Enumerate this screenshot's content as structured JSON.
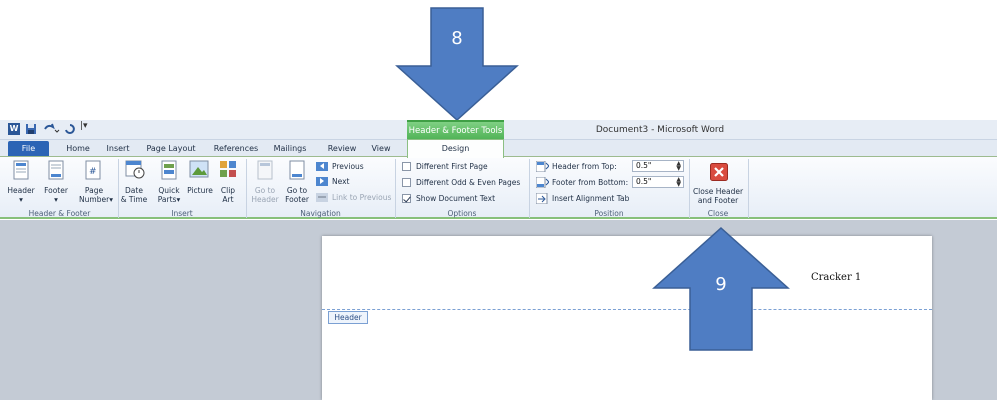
{
  "callouts": {
    "arrow1_number": "8",
    "arrow2_number": "9",
    "arrow_color": "#4f7dc3"
  },
  "window": {
    "document_title": "Document3  -  Microsoft Word",
    "contextual_tab": "Header & Footer Tools",
    "qat_icons": [
      "word-app-icon",
      "save-icon",
      "undo-icon",
      "redo-icon",
      "qat-customize-icon"
    ]
  },
  "tabs": [
    {
      "label": "File",
      "active": false
    },
    {
      "label": "Home",
      "active": false
    },
    {
      "label": "Insert",
      "active": false
    },
    {
      "label": "Page Layout",
      "active": false
    },
    {
      "label": "References",
      "active": false
    },
    {
      "label": "Mailings",
      "active": false
    },
    {
      "label": "Review",
      "active": false
    },
    {
      "label": "View",
      "active": false
    },
    {
      "label": "Design",
      "active": true
    }
  ],
  "ribbon": {
    "header_footer_group": {
      "label": "Header & Footer",
      "header": "Header",
      "footer": "Footer",
      "page_number_1": "Page",
      "page_number_2": "Number"
    },
    "insert_group": {
      "label": "Insert",
      "date_1": "Date",
      "date_2": "& Time",
      "quick_1": "Quick",
      "quick_2": "Parts",
      "picture": "Picture",
      "clip_1": "Clip",
      "clip_2": "Art"
    },
    "navigation_group": {
      "label": "Navigation",
      "goto_header_1": "Go to",
      "goto_header_2": "Header",
      "goto_footer_1": "Go to",
      "goto_footer_2": "Footer",
      "previous": "Previous",
      "next": "Next",
      "link_previous": "Link to Previous"
    },
    "options_group": {
      "label": "Options",
      "different_first": "Different First Page",
      "different_first_checked": false,
      "different_odd_even": "Different Odd & Even Pages",
      "different_odd_even_checked": false,
      "show_doc_text": "Show Document Text",
      "show_doc_text_checked": true
    },
    "position_group": {
      "label": "Position",
      "header_from_top": "Header from Top:",
      "header_from_top_value": "0.5\"",
      "footer_from_bottom": "Footer from Bottom:",
      "footer_from_bottom_value": "0.5\"",
      "insert_alignment_tab": "Insert Alignment Tab"
    },
    "close_group": {
      "label": "Close",
      "close_1": "Close Header",
      "close_2": "and Footer"
    }
  },
  "document": {
    "header_tag": "Header",
    "header_text": "Cracker 1"
  }
}
